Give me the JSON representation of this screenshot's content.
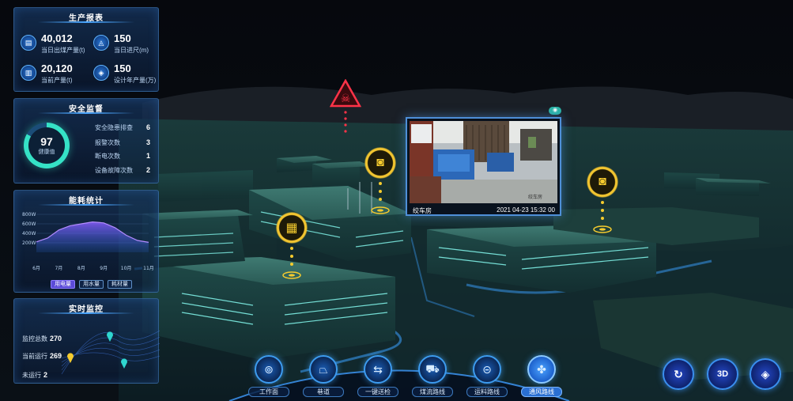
{
  "production": {
    "title": "生产报表",
    "stats": [
      {
        "value": "40,012",
        "label": "当日出煤产量(t)",
        "icon": "coal-icon"
      },
      {
        "value": "150",
        "label": "当日进尺(m)",
        "icon": "drill-icon"
      },
      {
        "value": "20,120",
        "label": "当前产量(t)",
        "icon": "output-icon"
      },
      {
        "value": "150",
        "label": "设计年产量(万)",
        "icon": "design-icon"
      }
    ]
  },
  "safety": {
    "title": "安全监督",
    "health_value": "97",
    "health_label": "健康值",
    "rows": [
      {
        "label": "安全隐患排查",
        "value": "6"
      },
      {
        "label": "报警次数",
        "value": "3"
      },
      {
        "label": "断电次数",
        "value": "1"
      },
      {
        "label": "设备故障次数",
        "value": "2"
      }
    ]
  },
  "energy": {
    "title": "能耗统计",
    "legend": [
      "用电量",
      "用水量",
      "耗材量"
    ],
    "colors": {
      "area_top": "#8a5cff",
      "area_bottom": "#2a6ee8"
    }
  },
  "chart_data": {
    "type": "area",
    "title": "能耗统计",
    "x": [
      "6月",
      "7月",
      "8月",
      "9月",
      "10月",
      "11月"
    ],
    "y_ticks": [
      "800W",
      "600W",
      "400W",
      "200W"
    ],
    "ylim": [
      0,
      800
    ],
    "series": [
      {
        "name": "用电量",
        "x": [
          6,
          6.5,
          7,
          7.5,
          8,
          8.5,
          9,
          9.5,
          10,
          10.5,
          11
        ],
        "values": [
          220,
          300,
          470,
          560,
          600,
          640,
          620,
          520,
          360,
          250,
          210
        ]
      }
    ],
    "legend": "bottom"
  },
  "monitor": {
    "title": "实时监控",
    "rows": [
      {
        "label": "监控总数",
        "value": "270"
      },
      {
        "label": "当前运行",
        "value": "269"
      },
      {
        "label": "未运行",
        "value": "2"
      }
    ]
  },
  "camera": {
    "location": "绞车房",
    "timestamp": "2021 04-23 15:32 00",
    "watermark": "绞车房"
  },
  "markers": [
    {
      "name": "danger-marker",
      "icon": "skull-warning-icon"
    },
    {
      "name": "camera-marker-1",
      "icon": "cctv-camera-icon"
    },
    {
      "name": "building-marker",
      "icon": "building-icon"
    },
    {
      "name": "camera-marker-2",
      "icon": "cctv-camera-icon"
    }
  ],
  "nav": [
    {
      "label": "工作面",
      "icon": "workface-icon",
      "active": false
    },
    {
      "label": "巷道",
      "icon": "tunnel-icon",
      "active": false
    },
    {
      "label": "一键送检",
      "icon": "transfer-icon",
      "active": false
    },
    {
      "label": "煤流路线",
      "icon": "cart-icon",
      "active": false
    },
    {
      "label": "运料路线",
      "icon": "conveyor-icon",
      "active": false
    },
    {
      "label": "通风路线",
      "icon": "fan-icon",
      "active": true
    }
  ],
  "tools": [
    {
      "name": "refresh-button",
      "icon": "rotate-icon"
    },
    {
      "name": "3d-view-button",
      "label": "3D"
    },
    {
      "name": "layers-button",
      "icon": "layers-icon"
    }
  ]
}
